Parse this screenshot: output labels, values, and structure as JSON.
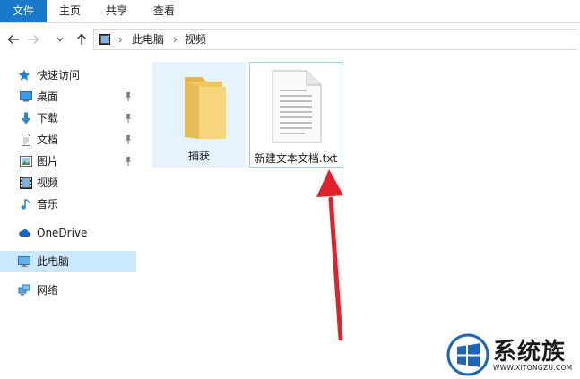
{
  "ribbon": {
    "tabs": [
      {
        "label": "文件"
      },
      {
        "label": "主页"
      },
      {
        "label": "共享"
      },
      {
        "label": "查看"
      }
    ]
  },
  "address": {
    "crumbs": [
      "此电脑",
      "视频"
    ]
  },
  "nav": {
    "quick_access": "快速访问",
    "items": [
      {
        "label": "桌面",
        "icon": "desktop-icon",
        "pinned": true
      },
      {
        "label": "下载",
        "icon": "download-icon",
        "pinned": true
      },
      {
        "label": "文档",
        "icon": "documents-icon",
        "pinned": true
      },
      {
        "label": "图片",
        "icon": "pictures-icon",
        "pinned": true
      },
      {
        "label": "视频",
        "icon": "videos-icon",
        "pinned": false
      },
      {
        "label": "音乐",
        "icon": "music-icon",
        "pinned": false
      }
    ],
    "onedrive": "OneDrive",
    "this_pc": "此电脑",
    "network": "网络"
  },
  "content": {
    "items": [
      {
        "name": "捕获",
        "type": "folder"
      },
      {
        "name": "新建文本文档.txt",
        "type": "text-file"
      }
    ]
  },
  "watermark": {
    "brand": "系统族",
    "site": "WWW.XITONGZU.COM"
  },
  "colors": {
    "accent": "#1979ca",
    "selection": "#cce8ff",
    "hover": "#e5f3ff",
    "arrow": "#e0202a"
  }
}
